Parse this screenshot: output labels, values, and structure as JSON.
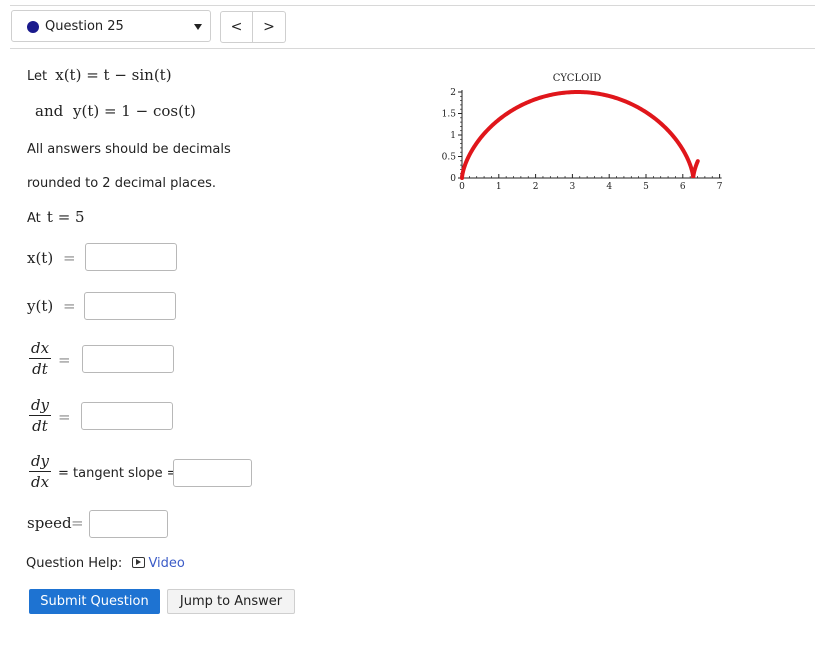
{
  "header": {
    "question_label": "Question 25",
    "prev_symbol": "<",
    "next_symbol": ">"
  },
  "problem": {
    "let_prefix": "Let",
    "x_def": "x(t) = t − sin(t)",
    "and_word": "and",
    "y_def": "y(t) = 1 − cos(t)",
    "instruction_1": "All answers should be decimals",
    "instruction_2": "rounded to 2 decimal places.",
    "at_prefix": "At",
    "at_value": "t = 5"
  },
  "fields": {
    "x_label": "x(t)",
    "y_label": "y(t)",
    "dxdt_num": "dx",
    "dxdt_den": "dt",
    "dydt_num": "dy",
    "dydt_den": "dt",
    "dydx_num": "dy",
    "dydx_den": "dx",
    "tangent_text": "= tangent slope =",
    "speed_label": "speed",
    "equals": "="
  },
  "help": {
    "label": "Question Help:",
    "video": "Video"
  },
  "buttons": {
    "submit": "Submit Question",
    "jump": "Jump to Answer"
  },
  "chart_data": {
    "type": "line",
    "title": "CYCLOID",
    "xlabel": "",
    "ylabel": "",
    "xlim": [
      0,
      7
    ],
    "ylim": [
      0,
      2
    ],
    "x_ticks": [
      "0",
      "1",
      "2",
      "3",
      "4",
      "5",
      "6",
      "7"
    ],
    "y_ticks": [
      "0",
      "0.5",
      "1",
      "1.5",
      "2"
    ],
    "series": [
      {
        "equation": "x = t - sin(t), y = 1 - cos(t)",
        "color": "#e0161b"
      }
    ]
  }
}
